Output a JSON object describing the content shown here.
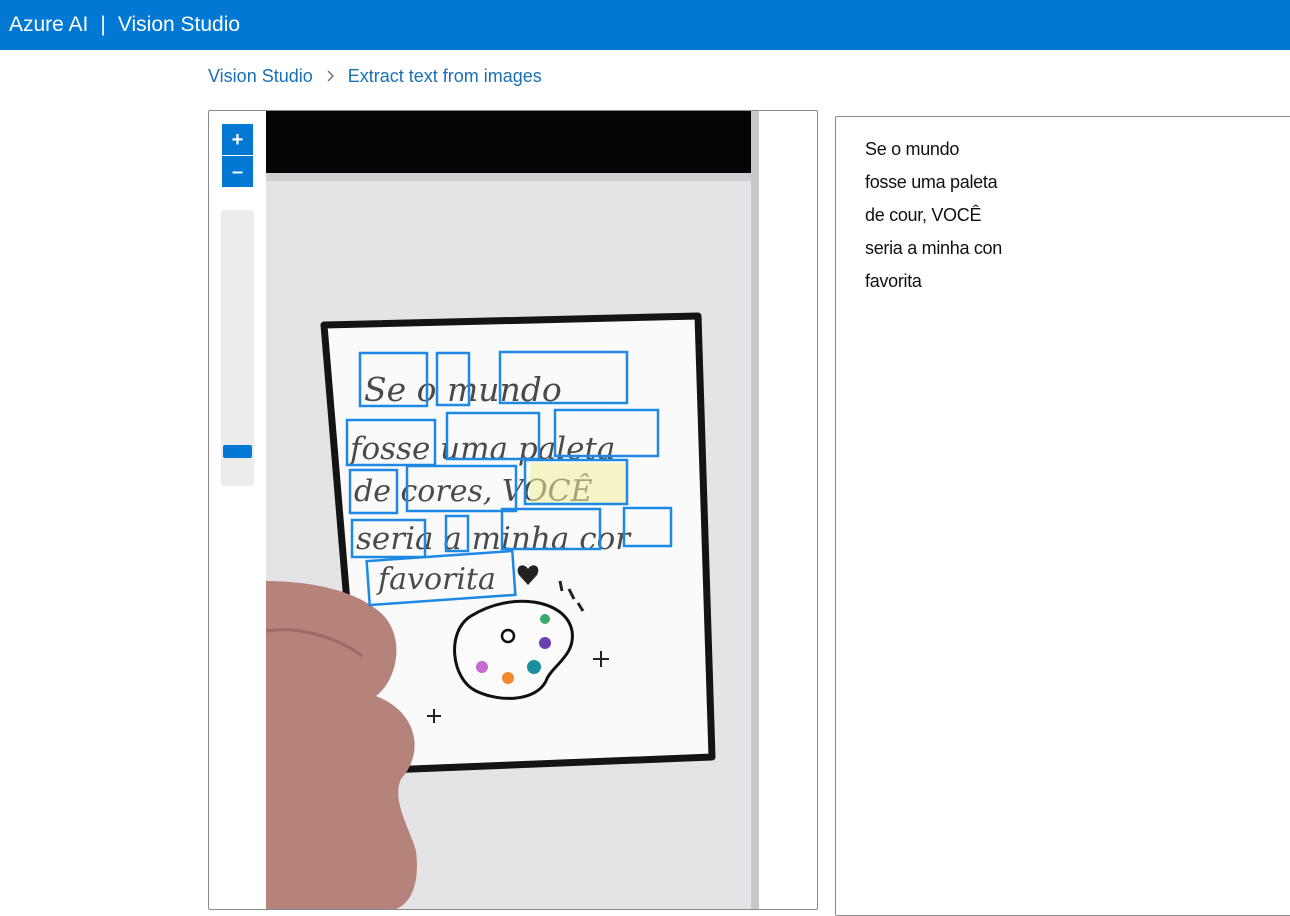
{
  "header": {
    "brand": "Azure AI",
    "separator": "|",
    "product": "Vision Studio"
  },
  "breadcrumb": {
    "home": "Vision Studio",
    "current": "Extract text from images"
  },
  "viewer": {
    "zoom_in_label": "+",
    "zoom_out_label": "–",
    "zoom_level": 0.1,
    "photo_handwriting": [
      "Se o mundo",
      "fosse uma paleta",
      "de cores, VOCÊ",
      "seria a minha cor",
      "favorita"
    ],
    "detected_words": [
      "Se",
      "o",
      "mundo",
      "fosse",
      "uma",
      "paleta",
      "de",
      "cores,",
      "VOCÊ",
      "seria",
      "a",
      "minha",
      "cor",
      "favorita"
    ]
  },
  "results": {
    "lines": [
      "Se o mundo",
      "fosse uma paleta",
      "de cour, VOCÊ",
      "seria a minha con",
      "favorita"
    ]
  },
  "colors": {
    "accent": "#0078d4",
    "link": "#1a6fb5",
    "box": "#1e88e5"
  }
}
